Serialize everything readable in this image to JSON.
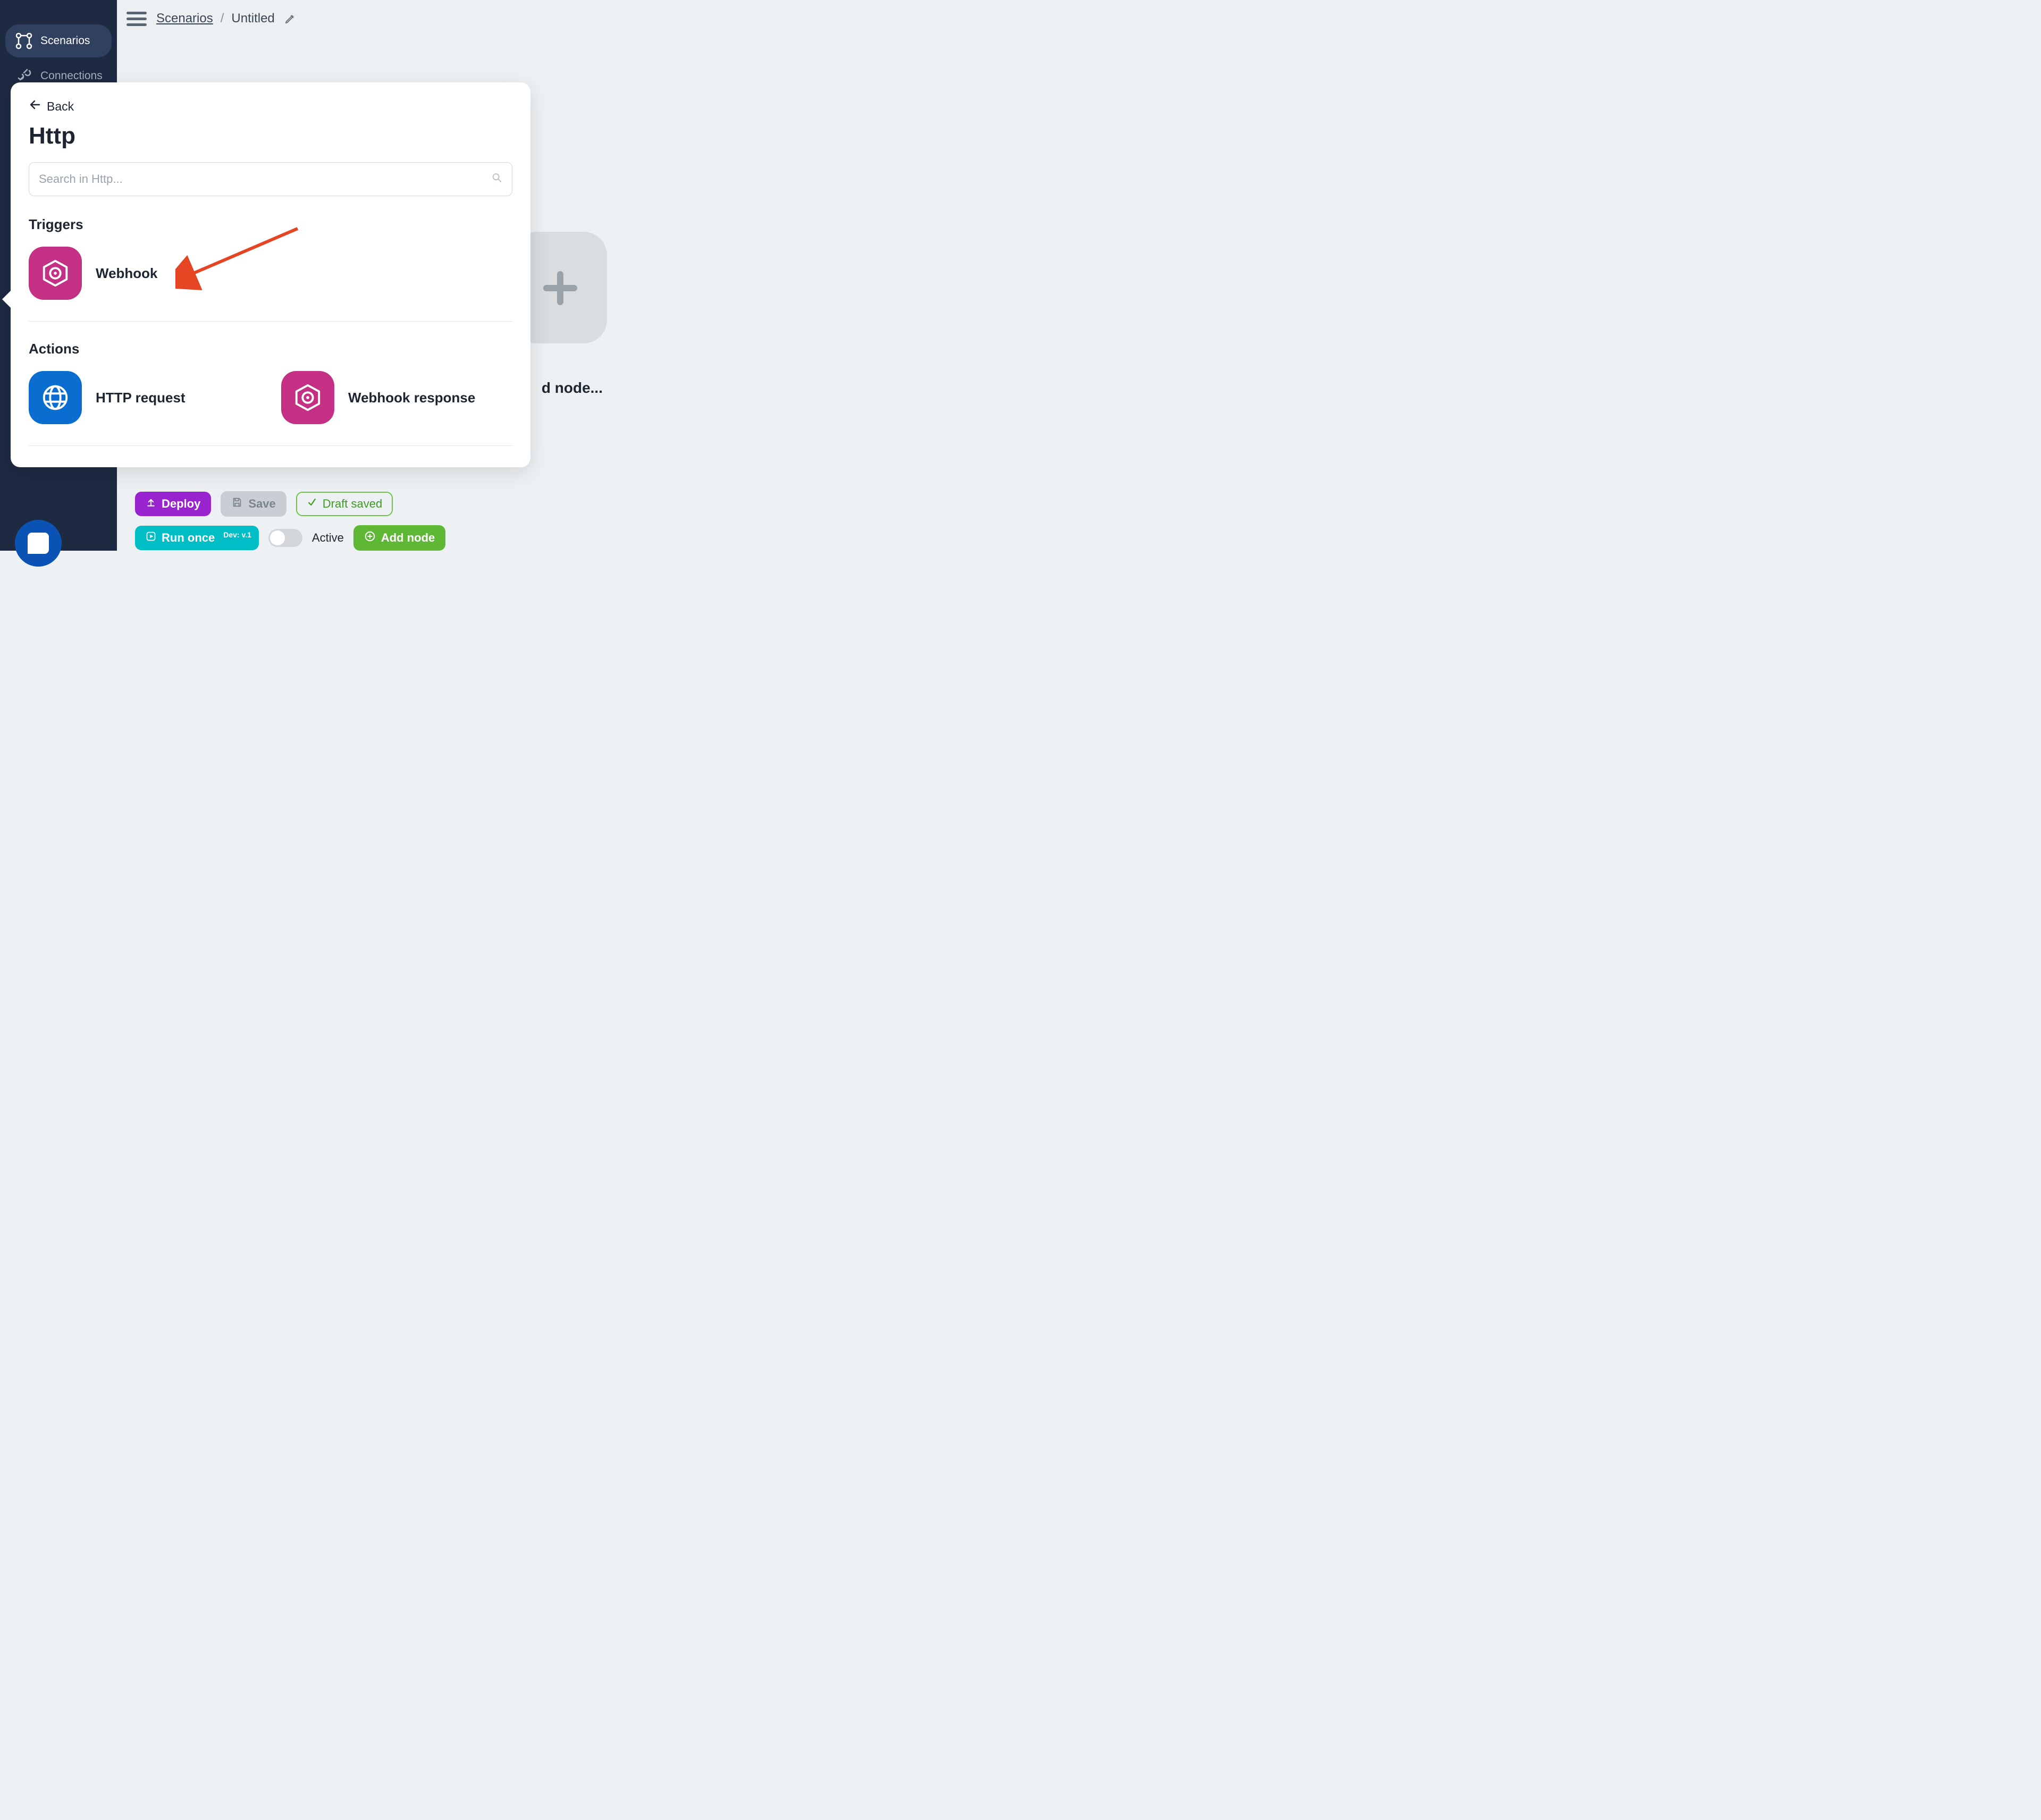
{
  "sidebar": {
    "items": [
      {
        "label": "Scenarios"
      },
      {
        "label": "Connections"
      }
    ]
  },
  "breadcrumb": {
    "root": "Scenarios",
    "title": "Untitled"
  },
  "canvas": {
    "add_node_caption": "d node..."
  },
  "panel": {
    "back_label": "Back",
    "title": "Http",
    "search_placeholder": "Search in Http...",
    "section_triggers": "Triggers",
    "section_actions": "Actions",
    "triggers": [
      {
        "label": "Webhook"
      }
    ],
    "actions": [
      {
        "label": "HTTP request"
      },
      {
        "label": "Webhook response"
      }
    ]
  },
  "bottombar": {
    "deploy": "Deploy",
    "save": "Save",
    "status_saved": "Draft saved",
    "run_once": "Run once",
    "run_version": "Dev: v.1",
    "active_label": "Active",
    "add_node": "Add node"
  }
}
